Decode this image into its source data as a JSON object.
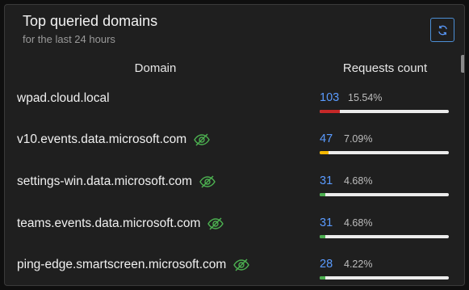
{
  "widget": {
    "title": "Top queried domains",
    "subtitle": "for the last 24 hours",
    "refresh_icon": "refresh-icon"
  },
  "columns": {
    "domain": "Domain",
    "requests": "Requests count"
  },
  "rows": [
    {
      "domain": "wpad.cloud.local",
      "count": "103",
      "percent": "15.54%",
      "fraction": 0.1554,
      "bar_color": "#c62828",
      "hidden_icon": false
    },
    {
      "domain": "v10.events.data.microsoft.com",
      "count": "47",
      "percent": "7.09%",
      "fraction": 0.0709,
      "bar_color": "#f5b800",
      "hidden_icon": true
    },
    {
      "domain": "settings-win.data.microsoft.com",
      "count": "31",
      "percent": "4.68%",
      "fraction": 0.0468,
      "bar_color": "#4caf50",
      "hidden_icon": true
    },
    {
      "domain": "teams.events.data.microsoft.com",
      "count": "31",
      "percent": "4.68%",
      "fraction": 0.0468,
      "bar_color": "#4caf50",
      "hidden_icon": true
    },
    {
      "domain": "ping-edge.smartscreen.microsoft.com",
      "count": "28",
      "percent": "4.22%",
      "fraction": 0.0422,
      "bar_color": "#4caf50",
      "hidden_icon": true
    }
  ],
  "colors": {
    "accent": "#5a9bff",
    "eye_icon": "#4caf50"
  }
}
